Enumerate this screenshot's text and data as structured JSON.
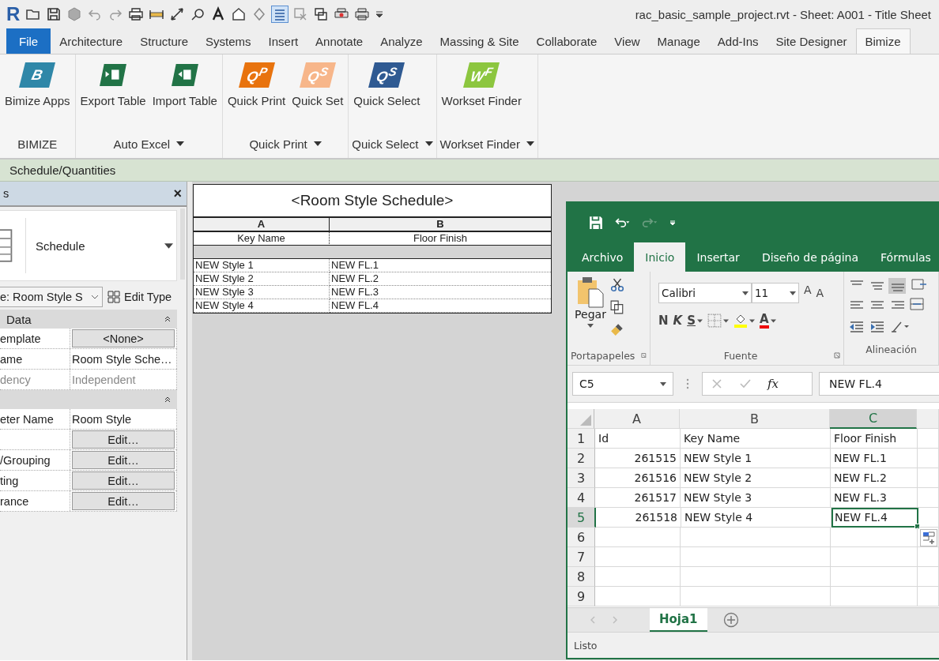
{
  "app": {
    "logo": "R",
    "title": "rac_basic_sample_project.rvt - Sheet: A001 - Title Sheet"
  },
  "tabs": [
    {
      "label": "File",
      "kind": "file",
      "selected": false
    },
    {
      "label": "Architecture",
      "kind": "tab",
      "selected": false
    },
    {
      "label": "Structure",
      "kind": "tab",
      "selected": false
    },
    {
      "label": "Systems",
      "kind": "tab",
      "selected": false
    },
    {
      "label": "Insert",
      "kind": "tab",
      "selected": false
    },
    {
      "label": "Annotate",
      "kind": "tab",
      "selected": false
    },
    {
      "label": "Analyze",
      "kind": "tab",
      "selected": false
    },
    {
      "label": "Massing & Site",
      "kind": "tab",
      "selected": false
    },
    {
      "label": "Collaborate",
      "kind": "tab",
      "selected": false
    },
    {
      "label": "View",
      "kind": "tab",
      "selected": false
    },
    {
      "label": "Manage",
      "kind": "tab",
      "selected": false
    },
    {
      "label": "Add-Ins",
      "kind": "tab",
      "selected": false
    },
    {
      "label": "Site Designer",
      "kind": "tab",
      "selected": false
    },
    {
      "label": "Bimize",
      "kind": "tab",
      "selected": true
    }
  ],
  "ribbon_groups": [
    {
      "label": "BIMIZE",
      "dropdown": false,
      "buttons": [
        {
          "label": "Bimize Apps",
          "kind": "letter",
          "mark": "B",
          "color": "#2f87a8"
        }
      ]
    },
    {
      "label": "Auto Excel",
      "dropdown": true,
      "buttons": [
        {
          "label": "Export Table",
          "kind": "export",
          "color": "#217346"
        },
        {
          "label": "Import Table",
          "kind": "import",
          "color": "#217346"
        }
      ]
    },
    {
      "label": "Quick Print",
      "dropdown": true,
      "buttons": [
        {
          "label": "Quick Print",
          "kind": "letter",
          "mark": "Q$^{P}$",
          "color": "#e8730e"
        },
        {
          "label": "Quick Set",
          "kind": "letter",
          "mark": "Q$^{S}$",
          "color": "#f7b68a"
        }
      ]
    },
    {
      "label": "Quick Select",
      "dropdown": true,
      "buttons": [
        {
          "label": "Quick Select",
          "kind": "letter",
          "mark": "Q$^{S}$",
          "color": "#2f5a92"
        }
      ]
    },
    {
      "label": "Workset Finder",
      "dropdown": true,
      "buttons": [
        {
          "label": "Workset Finder",
          "kind": "letter",
          "mark": "W$^{F}$",
          "color": "#8cc63f"
        }
      ]
    }
  ],
  "context_bar": {
    "label": "Schedule/Quantities"
  },
  "properties": {
    "title": "s",
    "close": "×",
    "type_name": "Schedule",
    "instance": "e: Room Style S",
    "edit_type": "Edit Type",
    "sections": [
      {
        "label": "Data",
        "rows": [
          {
            "name": "emplate",
            "value": "<None>",
            "kind": "button"
          },
          {
            "name": "ame",
            "value": "Room Style Sche…",
            "kind": "text",
            "disabled": false
          },
          {
            "name": "dency",
            "value": "Independent",
            "kind": "text",
            "disabled": true
          }
        ]
      },
      {
        "rows": [
          {
            "name": "eter Name",
            "value": "Room Style",
            "kind": "text",
            "disabled": false
          },
          {
            "value": "Edit…",
            "kind": "button"
          },
          {
            "name": "/Grouping",
            "value": "Edit…",
            "kind": "button"
          },
          {
            "name": "ting",
            "value": "Edit…",
            "kind": "button"
          },
          {
            "name": "rance",
            "value": "Edit…",
            "kind": "button"
          }
        ]
      }
    ]
  },
  "schedule": {
    "title": "<Room Style Schedule>",
    "column_letters": [
      "A",
      "B"
    ],
    "headers": [
      "Key Name",
      "Floor Finish"
    ],
    "rows": [
      [
        "NEW Style 1",
        "NEW FL.1"
      ],
      [
        "NEW Style 2",
        "NEW FL.2"
      ],
      [
        "NEW Style 3",
        "NEW FL.3"
      ],
      [
        "NEW Style 4",
        "NEW FL.4"
      ]
    ]
  },
  "excel": {
    "tabs": [
      {
        "label": "Archivo",
        "selected": false
      },
      {
        "label": "Inicio",
        "selected": true
      },
      {
        "label": "Insertar",
        "selected": false
      },
      {
        "label": "Diseño de página",
        "selected": false
      },
      {
        "label": "Fórmulas",
        "selected": false
      }
    ],
    "paste": "Pegar",
    "clipboard_group": "Portapapeles",
    "font": "Calibri",
    "font_size": "11",
    "grow": "A",
    "shrink": "A",
    "bold": "N",
    "italic": "K",
    "underline": "S",
    "font_color": "A",
    "font_group": "Fuente",
    "align_group": "Alineación",
    "name_box": "C5",
    "fx": "fx",
    "formula": "NEW FL.4",
    "columns": [
      {
        "label": "A",
        "selected": false
      },
      {
        "label": "B",
        "selected": false
      },
      {
        "label": "C",
        "selected": true
      }
    ],
    "rows": [
      {
        "num": "1",
        "kind": "header",
        "a": "Id",
        "b": "Key Name",
        "c": "Floor Finish",
        "selected": false
      },
      {
        "num": "2",
        "a": "261515",
        "b": "NEW Style 1",
        "c": "NEW FL.1",
        "selected": false
      },
      {
        "num": "3",
        "a": "261516",
        "b": "NEW Style 2",
        "c": "NEW FL.2",
        "selected": false
      },
      {
        "num": "4",
        "a": "261517",
        "b": "NEW Style 3",
        "c": "NEW FL.3",
        "selected": false
      },
      {
        "num": "5",
        "a": "261518",
        "b": "NEW Style 4",
        "c": "NEW FL.4",
        "selected": true
      },
      {
        "num": "6",
        "selected": false
      },
      {
        "num": "7",
        "selected": false
      },
      {
        "num": "8",
        "selected": false
      },
      {
        "num": "9",
        "selected": false
      }
    ],
    "sheet_tab": "Hoja1",
    "status": "Listo"
  }
}
